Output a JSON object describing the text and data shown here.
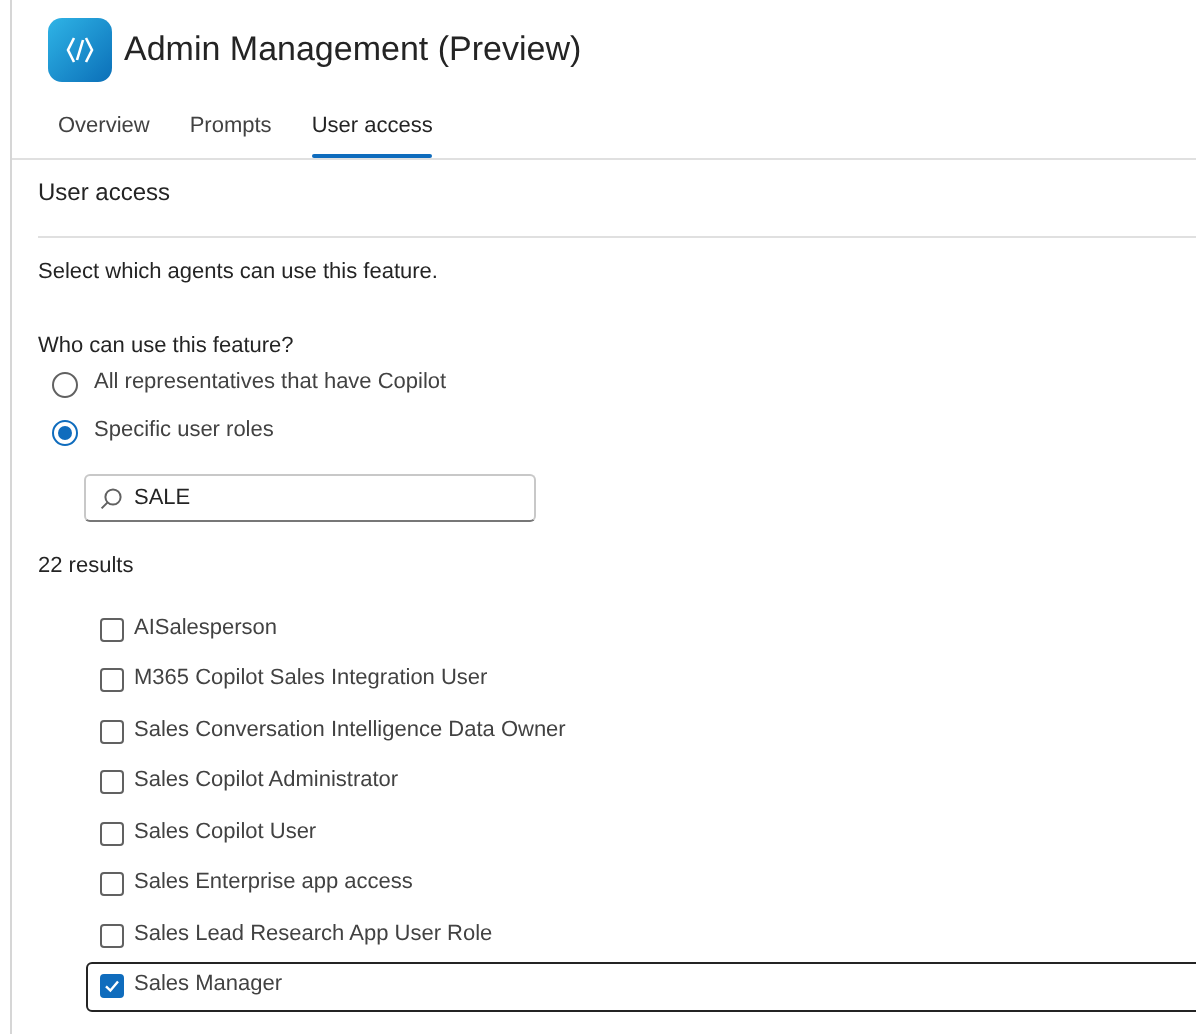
{
  "header": {
    "title": "Admin Management (Preview)"
  },
  "tabs": [
    {
      "label": "Overview",
      "selected": false
    },
    {
      "label": "Prompts",
      "selected": false
    },
    {
      "label": "User access",
      "selected": true
    }
  ],
  "section_title": "User access",
  "description": "Select which agents can use this feature.",
  "question": "Who can use this feature?",
  "options": [
    {
      "label": "All representatives that have Copilot",
      "selected": false
    },
    {
      "label": "Specific user roles",
      "selected": true
    }
  ],
  "search": {
    "value": "SALE"
  },
  "results_count": "22 results",
  "roles": [
    {
      "label": "AISalesperson",
      "checked": false,
      "focused": false
    },
    {
      "label": "M365 Copilot Sales Integration User",
      "checked": false,
      "focused": false
    },
    {
      "label": "Sales Conversation Intelligence Data Owner",
      "checked": false,
      "focused": false
    },
    {
      "label": "Sales Copilot Administrator",
      "checked": false,
      "focused": false
    },
    {
      "label": "Sales Copilot User",
      "checked": false,
      "focused": false
    },
    {
      "label": "Sales Enterprise app access",
      "checked": false,
      "focused": false
    },
    {
      "label": "Sales Lead Research App User Role",
      "checked": false,
      "focused": false
    },
    {
      "label": "Sales Manager",
      "checked": true,
      "focused": true
    }
  ]
}
